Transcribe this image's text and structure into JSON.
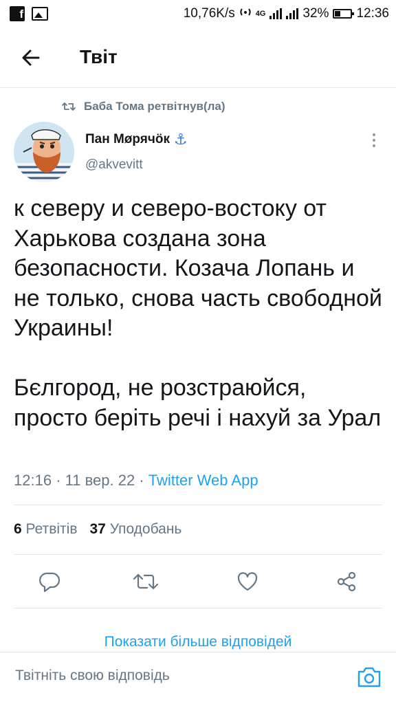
{
  "status_bar": {
    "net_speed": "10,76K/s",
    "network_type": "4G",
    "battery_percent": "32%",
    "battery_level": 0.32,
    "time": "12:36"
  },
  "header": {
    "title": "Твіт",
    "back_icon": "arrow-left-icon"
  },
  "tweet": {
    "retweeted_by": "Баба Тома ретвітнув(ла)",
    "author": {
      "name": "Пан Мøрячöк",
      "name_emoji": "⚓",
      "handle": "@akvevitt"
    },
    "text_paragraphs": [
      "к северу и северо-востоку от Харькова создана зона безопасности. Козача Лопань и не только, снова часть свободной Украины!",
      "Бєлгород, не розстраюйся, просто берiть речi і нахуй за Урал"
    ],
    "time": "12:16",
    "date": "11 вер. 22",
    "separator": "·",
    "source": "Twitter Web App",
    "retweets_count": "6",
    "retweets_label": "Ретвітів",
    "likes_count": "37",
    "likes_label": "Уподобань"
  },
  "actions": {
    "reply_icon": "reply-icon",
    "retweet_icon": "retweet-icon",
    "like_icon": "heart-icon",
    "share_icon": "share-icon"
  },
  "more_replies_label": "Показати більше відповідей",
  "reply_bar": {
    "placeholder": "Твітніть свою відповідь",
    "camera_icon": "camera-icon"
  },
  "colors": {
    "accent": "#1da1f2",
    "secondary_text": "#657786",
    "primary_text": "#14171a",
    "divider": "#e1e8ed"
  }
}
